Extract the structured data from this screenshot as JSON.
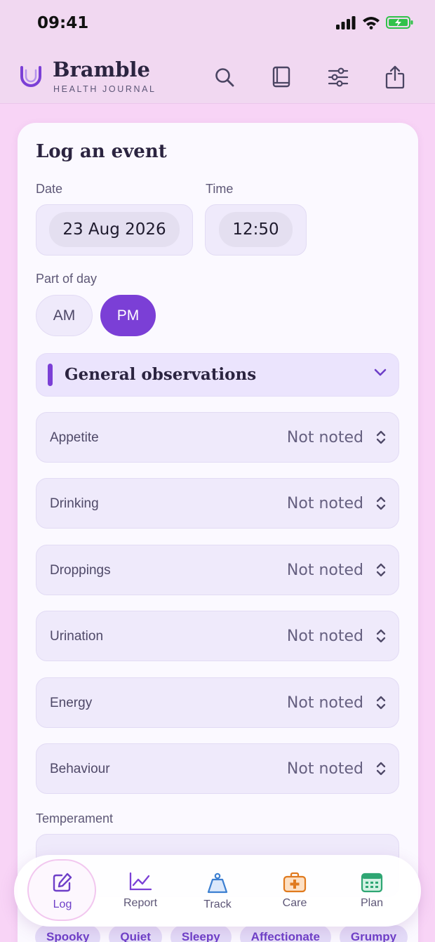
{
  "status": {
    "time": "09:41"
  },
  "app": {
    "name": "Bramble",
    "subtitle": "HEALTH JOURNAL"
  },
  "appbar_actions": [
    {
      "name": "search-icon"
    },
    {
      "name": "book-icon"
    },
    {
      "name": "sliders-icon"
    },
    {
      "name": "share-icon"
    }
  ],
  "form": {
    "title": "Log an event",
    "date_label": "Date",
    "date_value": "23 Aug 2026",
    "time_label": "Time",
    "time_value": "12:50",
    "part_of_day_label": "Part of day",
    "part_of_day_options": [
      "AM",
      "PM"
    ],
    "part_of_day_selected": "PM"
  },
  "section": {
    "title": "General observations",
    "expanded": true
  },
  "observations": [
    {
      "label": "Appetite",
      "value": "Not noted"
    },
    {
      "label": "Drinking",
      "value": "Not noted"
    },
    {
      "label": "Droppings",
      "value": "Not noted"
    },
    {
      "label": "Urination",
      "value": "Not noted"
    },
    {
      "label": "Energy",
      "value": "Not noted"
    },
    {
      "label": "Behaviour",
      "value": "Not noted"
    }
  ],
  "temperament": {
    "label": "Temperament",
    "chips": [
      "Spooky",
      "Quiet",
      "Sleepy",
      "Affectionate",
      "Grumpy"
    ]
  },
  "tabs": [
    {
      "label": "Log",
      "icon": "edit-icon",
      "active": true
    },
    {
      "label": "Report",
      "icon": "chart-icon",
      "active": false
    },
    {
      "label": "Track",
      "icon": "weight-icon",
      "active": false
    },
    {
      "label": "Care",
      "icon": "medkit-icon",
      "active": false
    },
    {
      "label": "Plan",
      "icon": "calendar-icon",
      "active": false
    }
  ],
  "colors": {
    "accent": "#7b3fd6",
    "background": "#f8d4f6",
    "card": "#fbf9ff"
  }
}
